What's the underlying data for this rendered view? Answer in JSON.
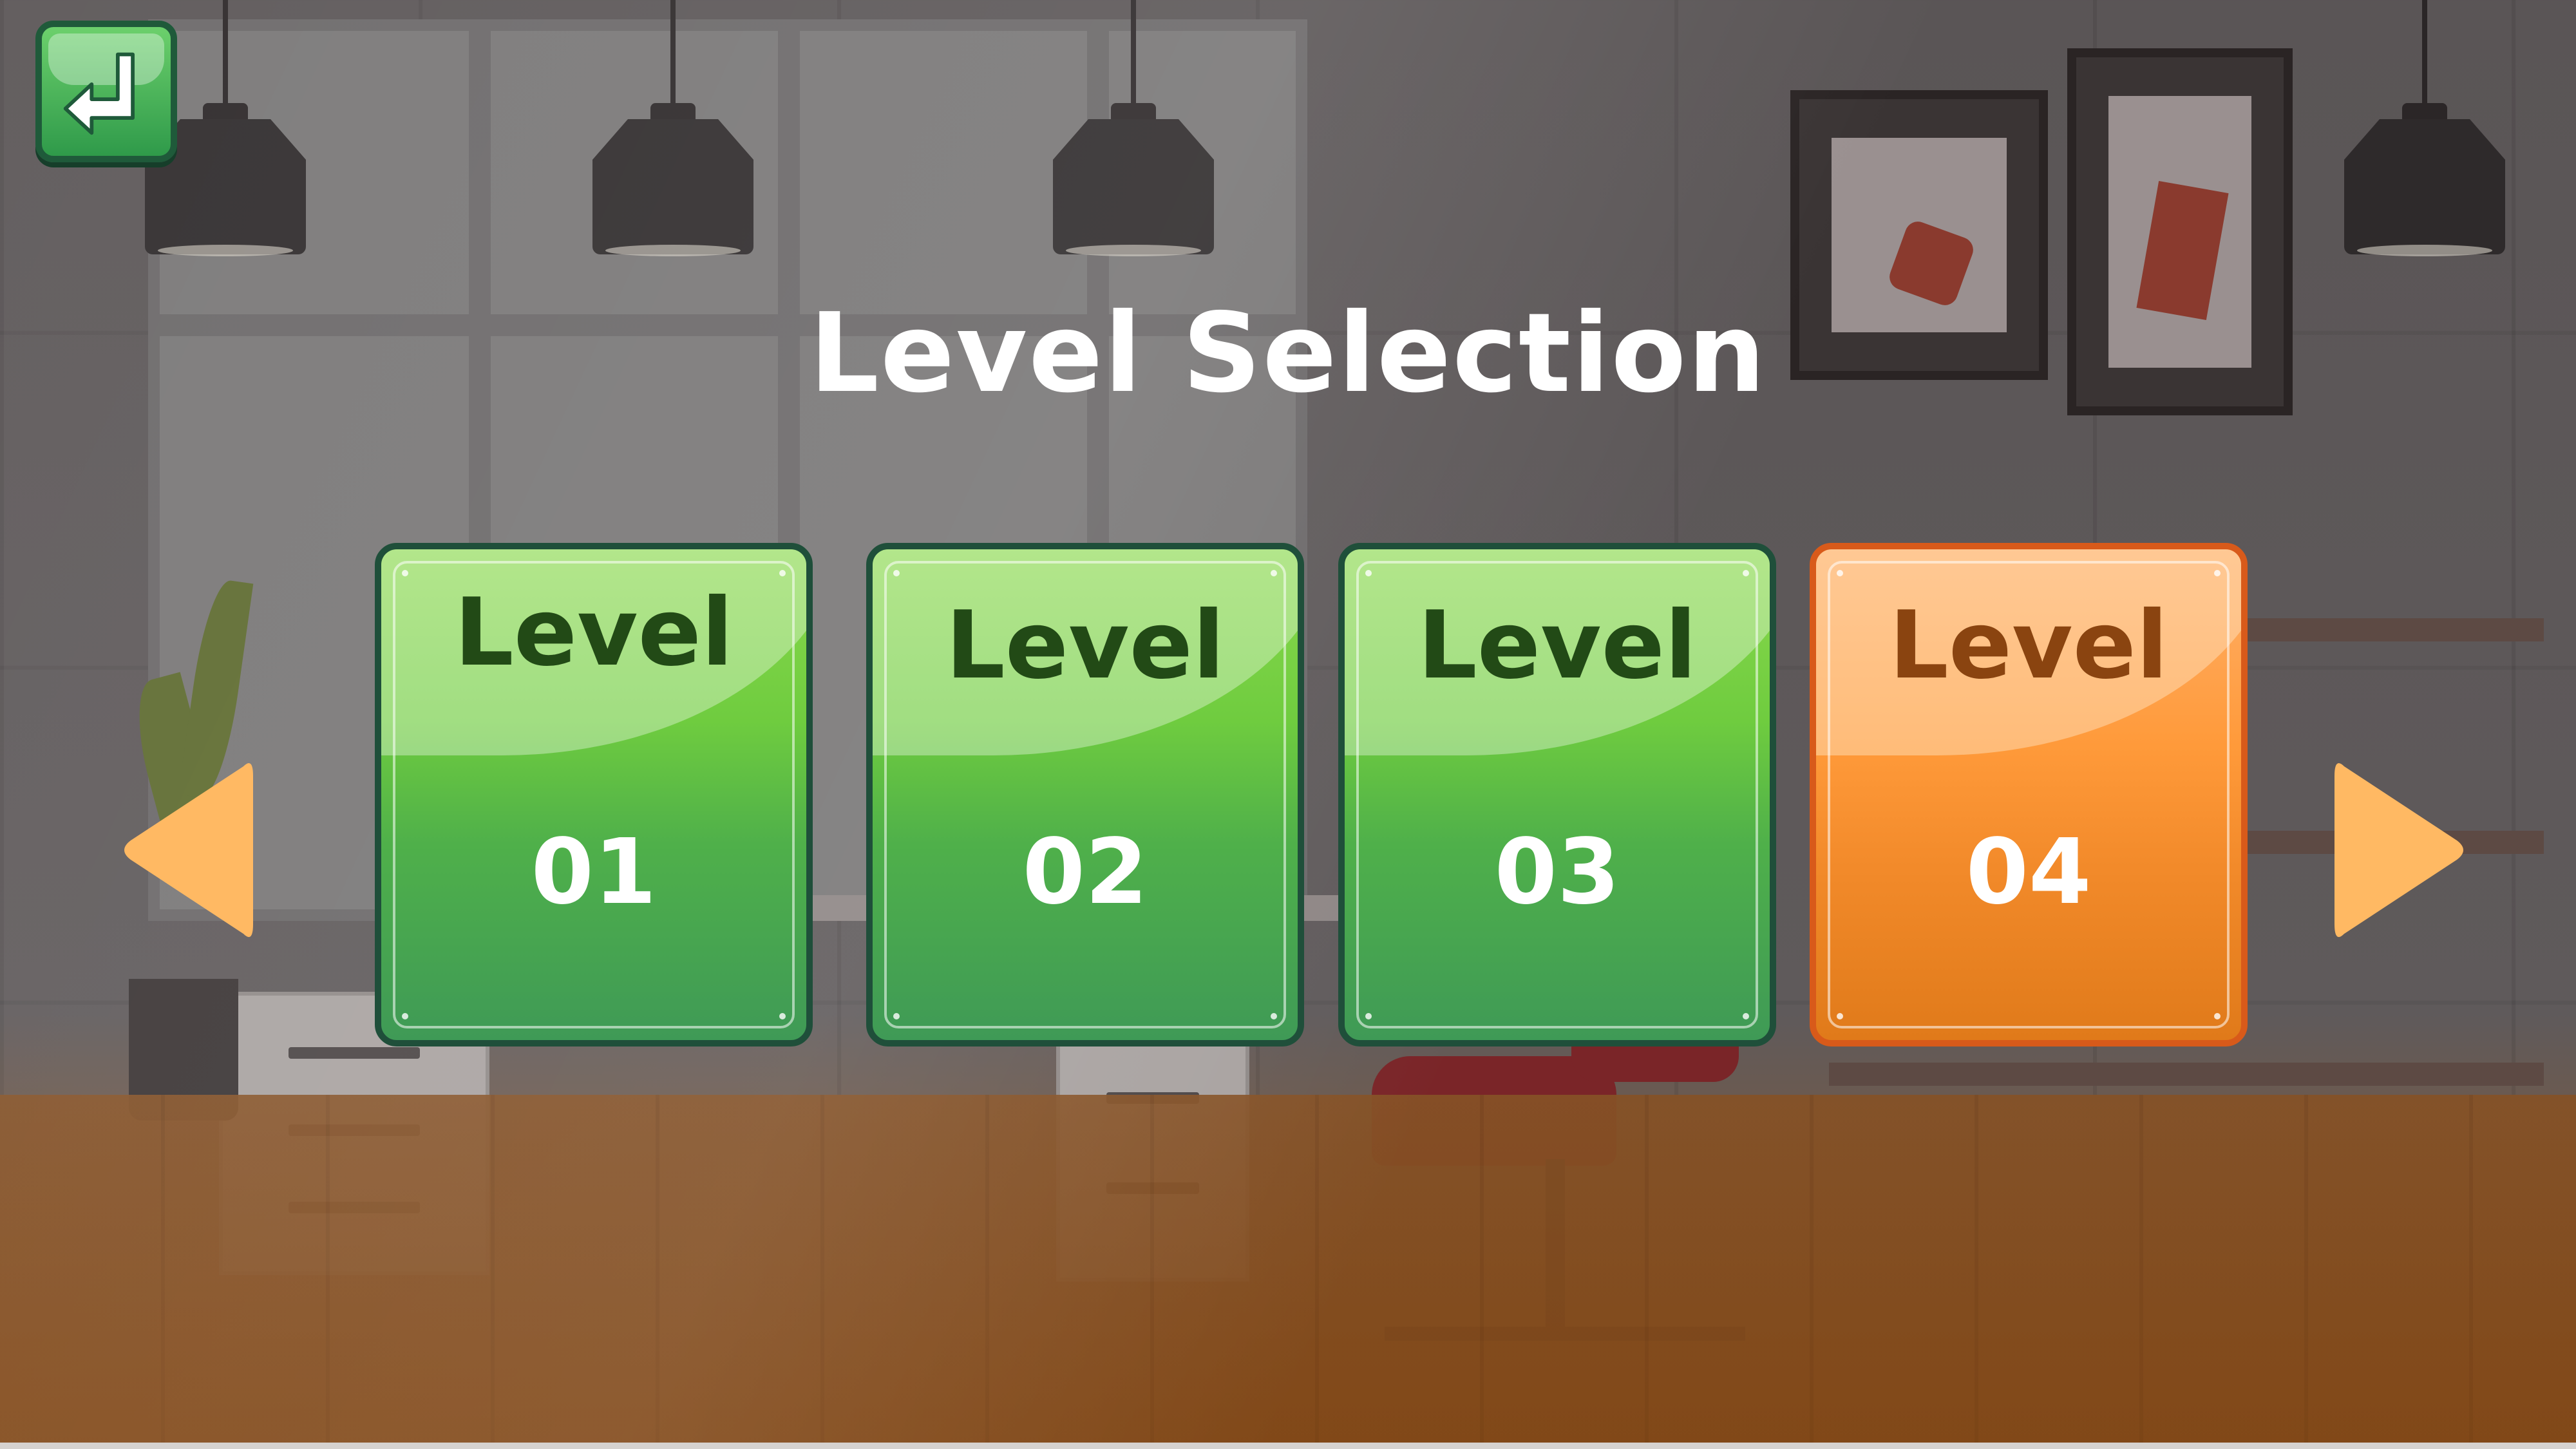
{
  "screen": {
    "title": "Level Selection"
  },
  "navigation": {
    "back_icon": "return-arrow-icon",
    "prev_icon": "left-triangle-arrow-icon",
    "next_icon": "right-triangle-arrow-icon"
  },
  "levels": [
    {
      "label": "Level",
      "number": "01",
      "color": "green"
    },
    {
      "label": "Level",
      "number": "02",
      "color": "green"
    },
    {
      "label": "Level",
      "number": "03",
      "color": "green"
    },
    {
      "label": "Level",
      "number": "04",
      "color": "orange"
    }
  ],
  "colors": {
    "title": "#ffffff",
    "card_green": "#5cbf45",
    "card_orange": "#ff9a3a",
    "arrow": "#ffb963",
    "back_button": "#3fae55"
  }
}
